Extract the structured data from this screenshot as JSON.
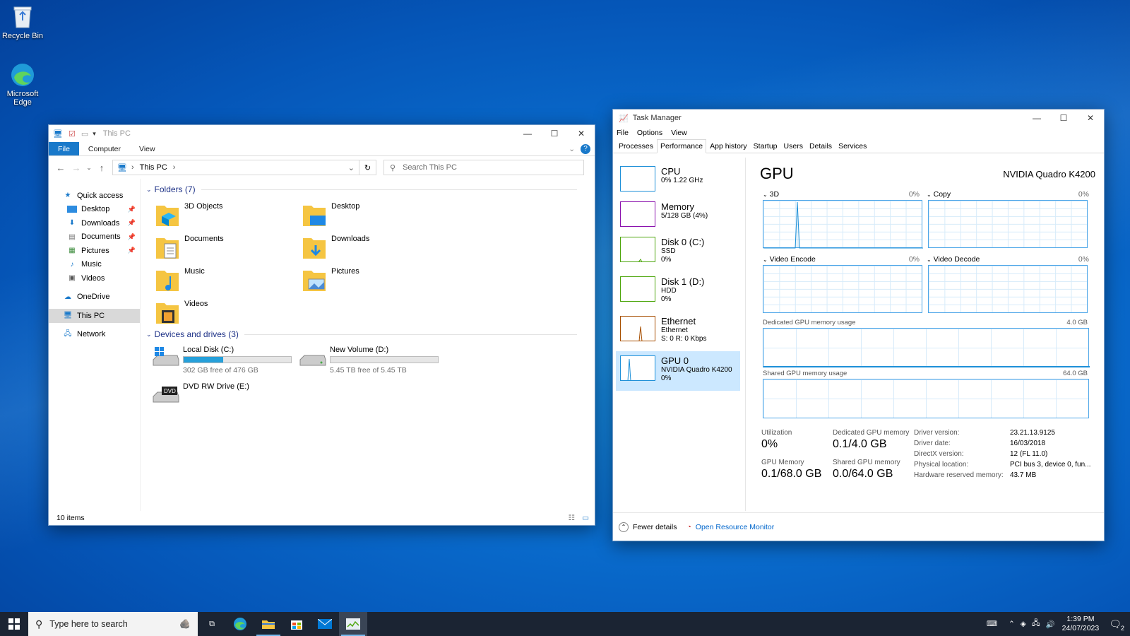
{
  "desktop": {
    "icons": [
      {
        "label": "Recycle Bin"
      },
      {
        "label": "Microsoft Edge"
      }
    ]
  },
  "explorer": {
    "title": "This PC",
    "ribbon_tabs": [
      "File",
      "Computer",
      "View"
    ],
    "address": "This PC",
    "search_placeholder": "Search This PC",
    "nav": {
      "quick_access": "Quick access",
      "items": [
        "Desktop",
        "Downloads",
        "Documents",
        "Pictures",
        "Music",
        "Videos"
      ],
      "onedrive": "OneDrive",
      "this_pc": "This PC",
      "network": "Network"
    },
    "folders_header": "Folders (7)",
    "folders": [
      "3D Objects",
      "Desktop",
      "Documents",
      "Downloads",
      "Music",
      "Pictures",
      "Videos"
    ],
    "drives_header": "Devices and drives (3)",
    "drives": [
      {
        "name": "Local Disk (C:)",
        "free": "302 GB free of 476 GB",
        "used_fraction": 0.37
      },
      {
        "name": "New Volume (D:)",
        "free": "5.45 TB free of 5.45 TB",
        "used_fraction": 0.0
      },
      {
        "name": "DVD RW Drive (E:)"
      }
    ],
    "status": "10 items"
  },
  "taskmgr": {
    "title": "Task Manager",
    "menu": [
      "File",
      "Options",
      "View"
    ],
    "tabs": [
      "Processes",
      "Performance",
      "App history",
      "Startup",
      "Users",
      "Details",
      "Services"
    ],
    "active_tab": "Performance",
    "resources": [
      {
        "name": "CPU",
        "sub1": "0% 1.22 GHz",
        "sub2": "",
        "sub3": "",
        "color": "#1e90d8"
      },
      {
        "name": "Memory",
        "sub1": "5/128 GB (4%)",
        "sub2": "",
        "sub3": "",
        "color": "#8b12ae"
      },
      {
        "name": "Disk 0 (C:)",
        "sub1": "SSD",
        "sub2": "0%",
        "sub3": "",
        "color": "#4da60c"
      },
      {
        "name": "Disk 1 (D:)",
        "sub1": "HDD",
        "sub2": "0%",
        "sub3": "",
        "color": "#4da60c"
      },
      {
        "name": "Ethernet",
        "sub1": "Ethernet",
        "sub2": "S: 0 R: 0 Kbps",
        "sub3": "",
        "color": "#a74f01"
      },
      {
        "name": "GPU 0",
        "sub1": "NVIDIA Quadro K4200",
        "sub2": "0%",
        "sub3": "",
        "color": "#1e90d8"
      }
    ],
    "gpu": {
      "heading": "GPU",
      "model": "NVIDIA Quadro K4200",
      "engines": [
        {
          "name": "3D",
          "pct": "0%"
        },
        {
          "name": "Copy",
          "pct": "0%"
        },
        {
          "name": "Video Encode",
          "pct": "0%"
        },
        {
          "name": "Video Decode",
          "pct": "0%"
        }
      ],
      "dedicated_label": "Dedicated GPU memory usage",
      "dedicated_max": "4.0 GB",
      "shared_label": "Shared GPU memory usage",
      "shared_max": "64.0 GB",
      "stats": [
        {
          "label": "Utilization",
          "value": "0%"
        },
        {
          "label": "Dedicated GPU memory",
          "value": "0.1/4.0 GB"
        },
        {
          "label": "GPU Memory",
          "value": "0.1/68.0 GB"
        },
        {
          "label": "Shared GPU memory",
          "value": "0.0/64.0 GB"
        }
      ],
      "details": [
        {
          "k": "Driver version:",
          "v": "23.21.13.9125"
        },
        {
          "k": "Driver date:",
          "v": "16/03/2018"
        },
        {
          "k": "DirectX version:",
          "v": "12 (FL 11.0)"
        },
        {
          "k": "Physical location:",
          "v": "PCI bus 3, device 0, fun..."
        },
        {
          "k": "Hardware reserved memory:",
          "v": "43.7 MB"
        }
      ]
    },
    "footer": {
      "fewer": "Fewer details",
      "monitor": "Open Resource Monitor"
    }
  },
  "taskbar": {
    "search_placeholder": "Type here to search",
    "time": "1:39 PM",
    "date": "24/07/2023",
    "notifications": "2"
  }
}
